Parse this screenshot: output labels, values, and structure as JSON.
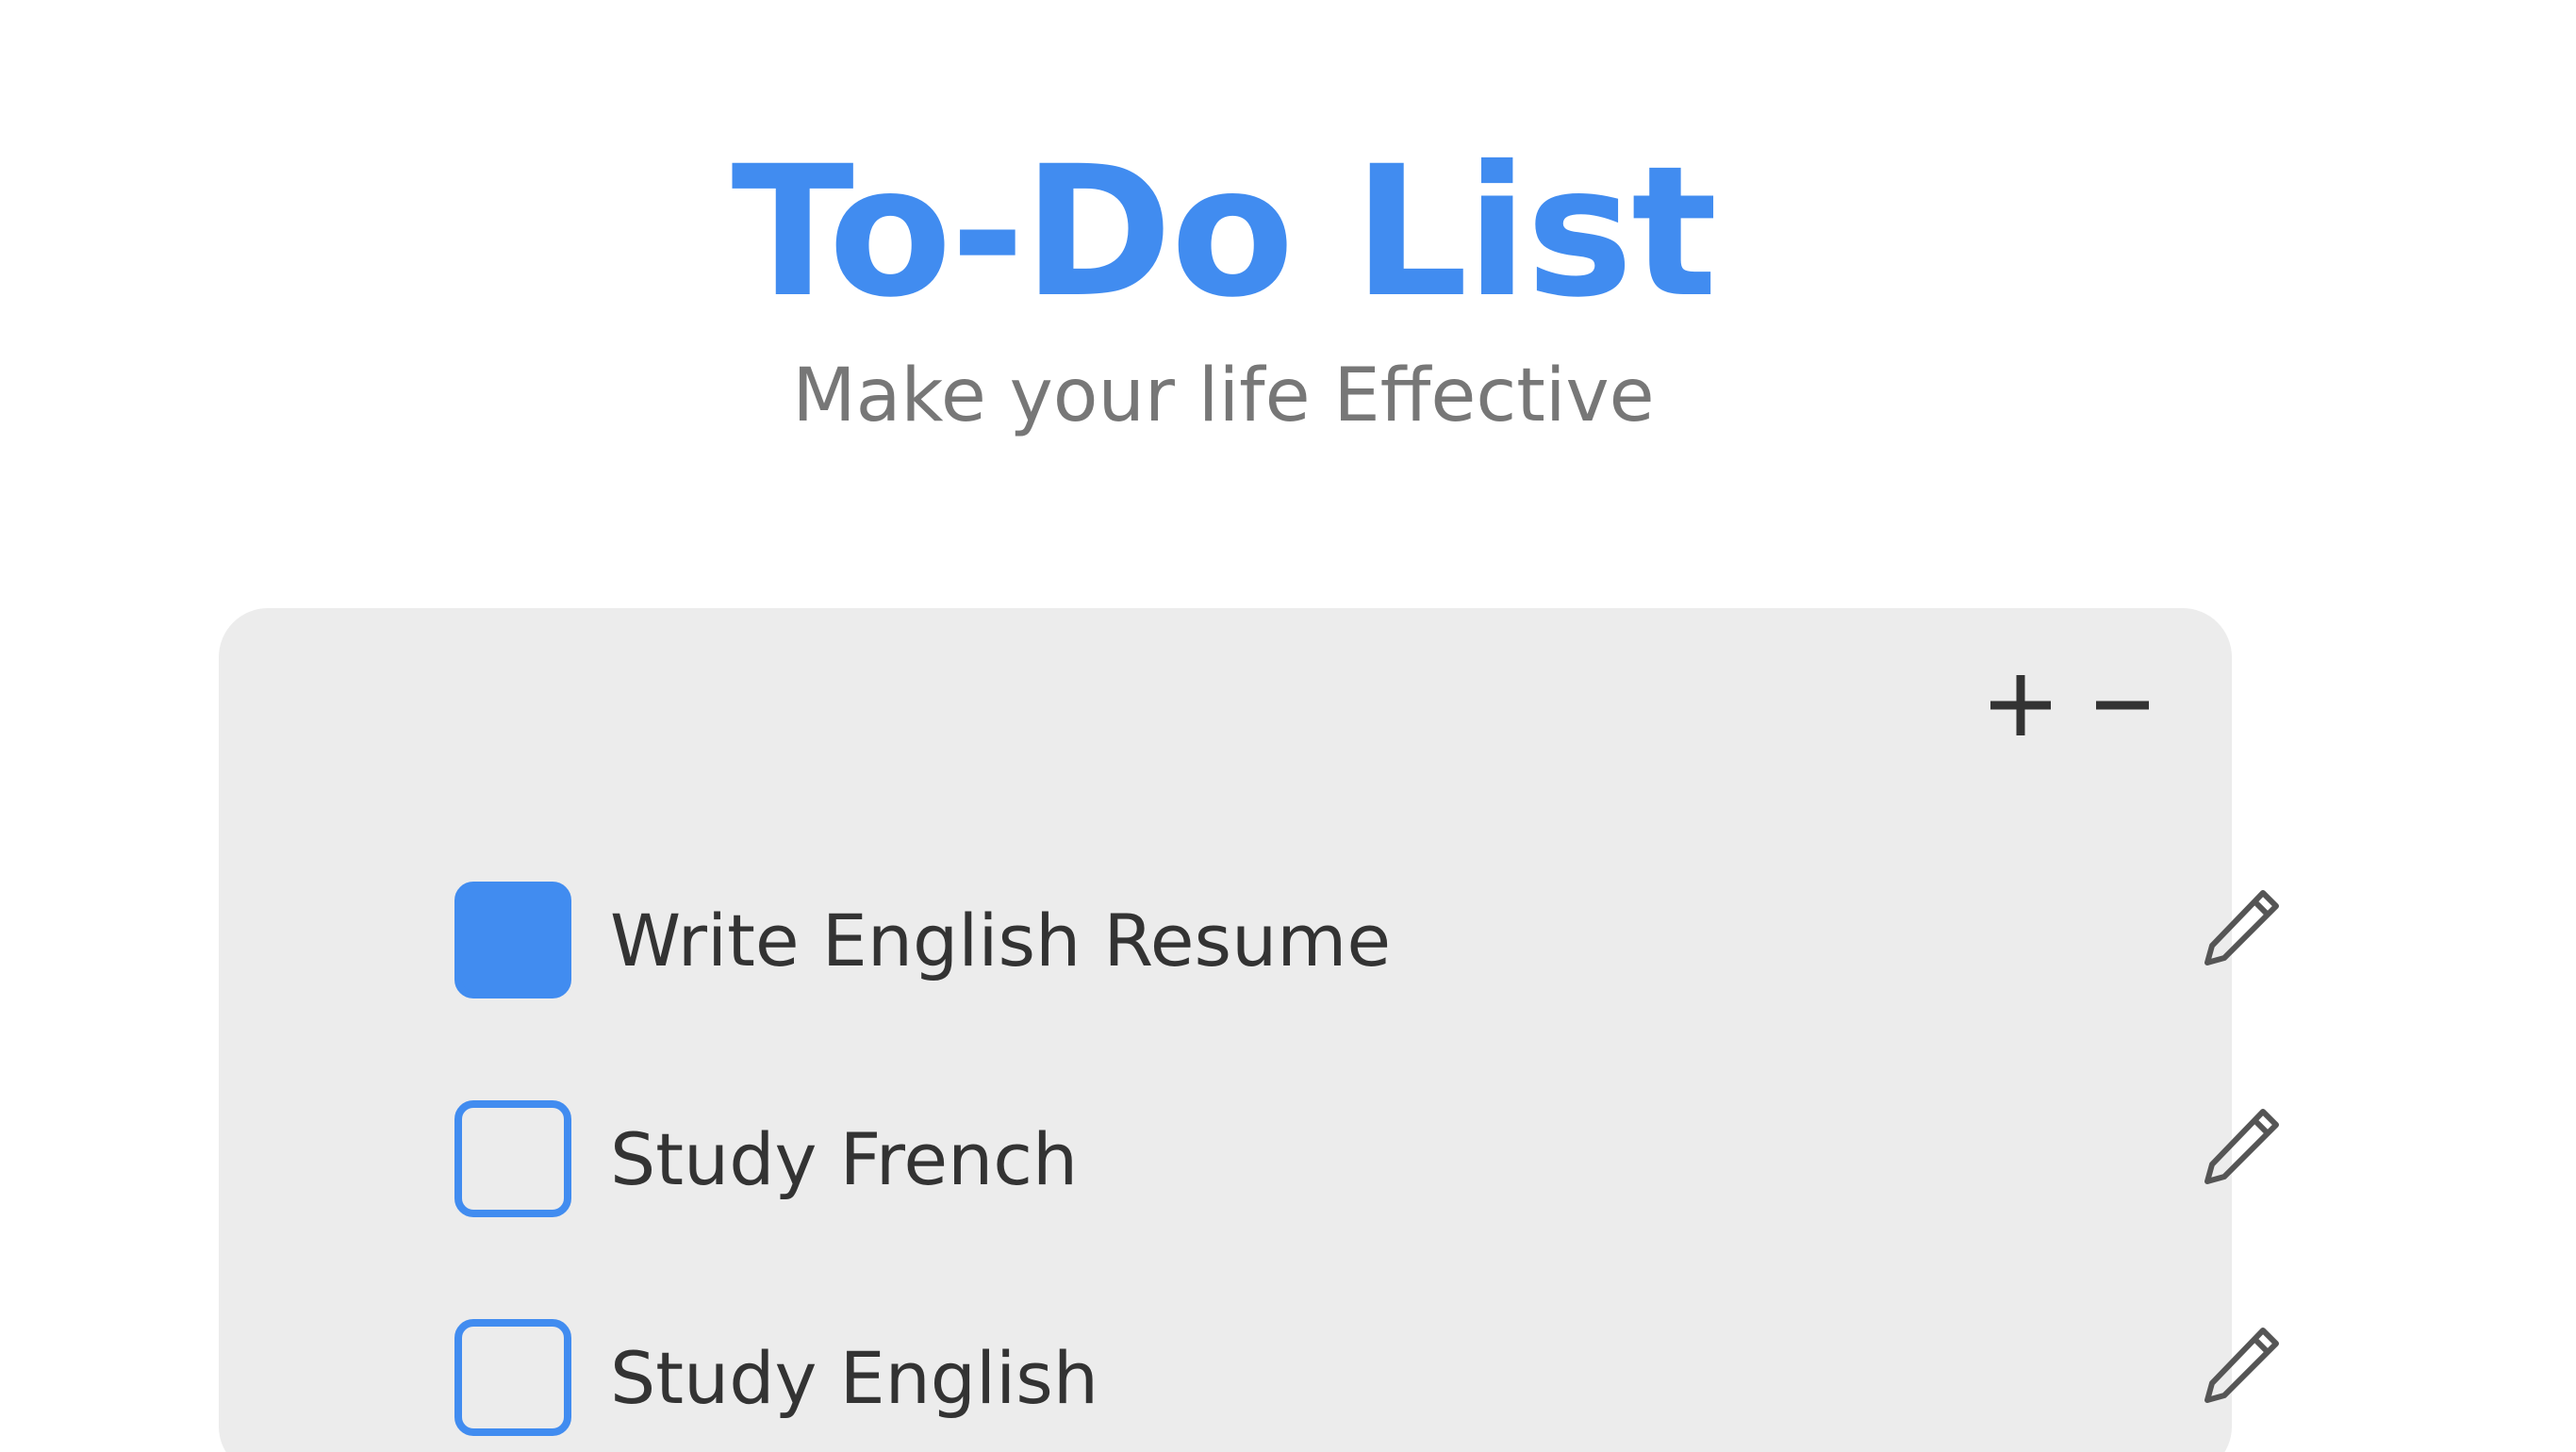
{
  "header": {
    "title": "To-Do List",
    "subtitle": "Make your life Effective"
  },
  "toolbar": {
    "add_icon": "plus-icon",
    "remove_icon": "minus-icon"
  },
  "todos": [
    {
      "label": "Write English Resume",
      "checked": true,
      "edit_icon": "pencil-icon"
    },
    {
      "label": "Study French",
      "checked": false,
      "edit_icon": "pencil-icon"
    },
    {
      "label": "Study English",
      "checked": false,
      "edit_icon": "pencil-icon"
    }
  ],
  "colors": {
    "accent": "#418cf0",
    "subtitle": "#777777",
    "panel": "#ececec",
    "text": "#333333"
  }
}
